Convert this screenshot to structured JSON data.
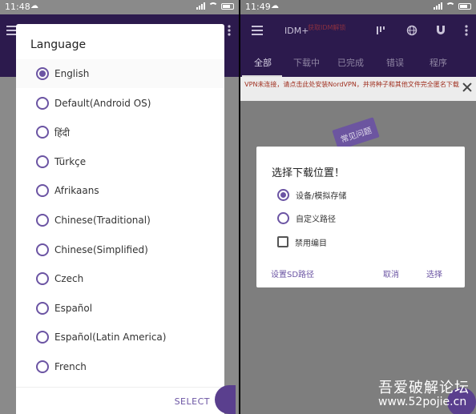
{
  "left": {
    "status": {
      "time": "11:48",
      "notification_icon": "cloud-icon"
    },
    "language_dialog": {
      "title": "Language",
      "options": [
        {
          "label": "English",
          "selected": true
        },
        {
          "label": "Default(Android OS)",
          "selected": false
        },
        {
          "label": "हिंदी",
          "selected": false
        },
        {
          "label": "Türkçe",
          "selected": false
        },
        {
          "label": "Afrikaans",
          "selected": false
        },
        {
          "label": "Chinese(Traditional)",
          "selected": false
        },
        {
          "label": "Chinese(Simplified)",
          "selected": false
        },
        {
          "label": "Czech",
          "selected": false
        },
        {
          "label": "Español",
          "selected": false
        },
        {
          "label": "Español(Latin America)",
          "selected": false
        },
        {
          "label": "French",
          "selected": false
        }
      ],
      "select_label": "SELECT"
    }
  },
  "right": {
    "status": {
      "time": "11:49",
      "notification_icon": "cloud-icon"
    },
    "appbar": {
      "title": "IDM+",
      "title_note": "获取IDM解锁",
      "icons": [
        "menu-icon",
        "sort-icon",
        "globe-icon",
        "magnet-icon",
        "more-vert-icon"
      ]
    },
    "tabs": [
      "全部",
      "下载中",
      "已完成",
      "错误",
      "程序"
    ],
    "vpn_banner": {
      "text": "VPN未连接，请点击此处安装NordVPN，并将种子和其他文件完全匿名下载"
    },
    "faq_badge": "常见问题",
    "location_dialog": {
      "title": "选择下载位置！",
      "options": [
        {
          "label": "设备/模拟存储",
          "type": "radio",
          "checked": true
        },
        {
          "label": "自定义路径",
          "type": "radio",
          "checked": false
        },
        {
          "label": "禁用编目",
          "type": "checkbox",
          "checked": false
        }
      ],
      "set_sd_label": "设置SD路径",
      "cancel_label": "取消",
      "choose_label": "选择"
    },
    "watermark": {
      "name": "吾爱破解论坛",
      "url": "www.52pojie.cn"
    }
  },
  "colors": {
    "accent": "#6b54a3",
    "appbar": "#2c1a4d",
    "banner_text": "#a03020"
  }
}
